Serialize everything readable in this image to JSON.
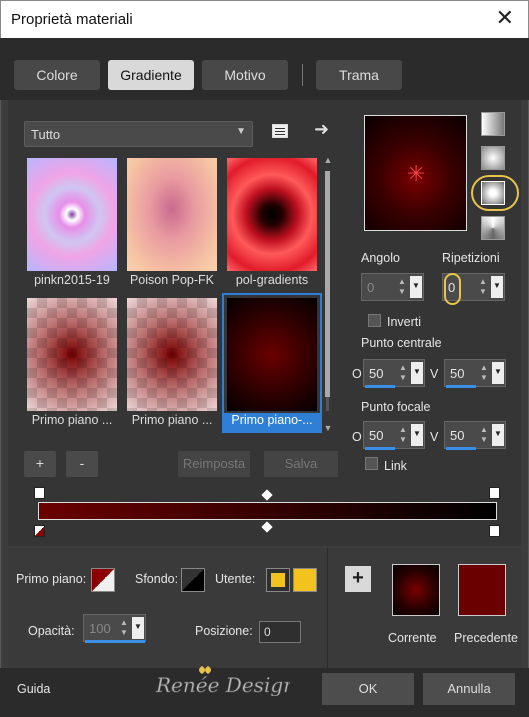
{
  "window": {
    "title": "Proprietà materiali",
    "close_glyph": "✕"
  },
  "tabs": [
    {
      "label": "Colore",
      "active": false
    },
    {
      "label": "Gradiente",
      "active": true
    },
    {
      "label": "Motivo",
      "active": false
    },
    {
      "label": "Trama",
      "active": false
    }
  ],
  "library": {
    "category": "Tutto",
    "items": [
      {
        "label": "pinkn2015-19",
        "selected": false
      },
      {
        "label": "Poison Pop-FK",
        "selected": false
      },
      {
        "label": "pol-gradients",
        "selected": false
      },
      {
        "label": "Primo piano ...",
        "selected": false
      },
      {
        "label": "Primo piano ...",
        "selected": false
      },
      {
        "label": "Primo piano-...",
        "selected": true
      }
    ],
    "buttons": {
      "add": "+",
      "remove": "-",
      "reset": "Reimposta",
      "save": "Salva"
    }
  },
  "gradient": {
    "angle_label": "Angolo",
    "angle_value": "0",
    "repeat_label": "Ripetizioni",
    "repeat_value": "0",
    "invert_label": "Inverti",
    "center_label": "Punto centrale",
    "center_h_label": "O",
    "center_h": "50",
    "center_v_label": "V",
    "center_v": "50",
    "focal_label": "Punto focale",
    "focal_h_label": "O",
    "focal_h": "50",
    "focal_v_label": "V",
    "focal_v": "50",
    "link_label": "Link",
    "start_color": "#6b0000",
    "end_color": "#000000"
  },
  "materials": {
    "foreground_label": "Primo piano:",
    "background_label": "Sfondo:",
    "user_label": "Utente:",
    "user_color": "#f2c21f",
    "opacity_label": "Opacità:",
    "opacity_value": "100",
    "position_label": "Posizione:",
    "position_value": "0",
    "current_label": "Corrente",
    "previous_label": "Precedente",
    "previous_color": "#6b0000"
  },
  "footer": {
    "help": "Guida",
    "ok": "OK",
    "cancel": "Annulla",
    "watermark": "Renée Design"
  }
}
